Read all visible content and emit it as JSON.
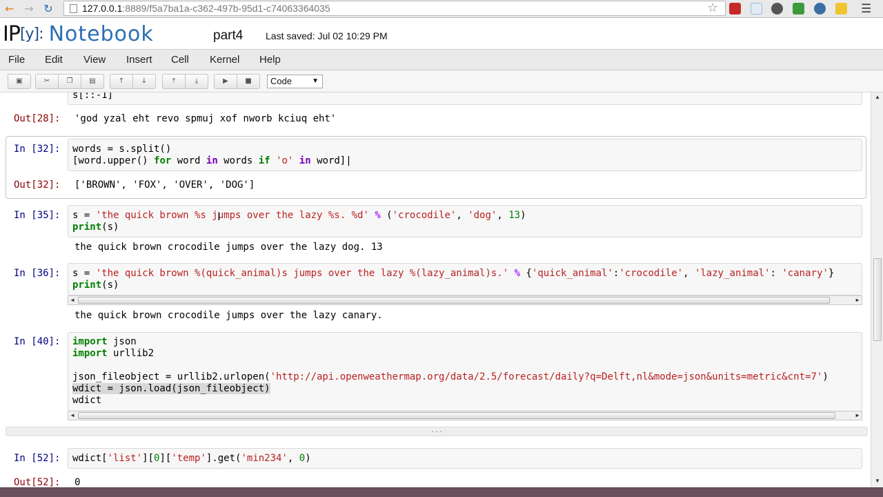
{
  "browser": {
    "url_host": "127.0.0.1",
    "url_path": ":8889/f5a7ba1a-c362-497b-95d1-c74063364035",
    "back_icon": "arrow-left-icon",
    "forward_icon": "arrow-right-icon",
    "reload_icon": "reload-icon",
    "bookmark_icon": "star-icon",
    "menu_icon": "hamburger-icon"
  },
  "header": {
    "logo_ip": "IP",
    "logo_y": "[y]:",
    "logo_notebook": "Notebook",
    "notebook_name": "part4",
    "last_saved": "Last saved: Jul 02 10:29 PM"
  },
  "menu": {
    "items": [
      "File",
      "Edit",
      "View",
      "Insert",
      "Cell",
      "Kernel",
      "Help"
    ]
  },
  "toolbar": {
    "cell_type": "Code",
    "cell_type_options": [
      "Code"
    ]
  },
  "cells": {
    "c28": {
      "partial_input": "s[::-1]",
      "out_prompt": "Out[28]:",
      "output": "'god yzal eht revo spmuj xof nworb kciuq eht'"
    },
    "c32": {
      "in_prompt": "In [32]:",
      "out_prompt": "Out[32]:",
      "output": "['BROWN', 'FOX', 'OVER', 'DOG']"
    },
    "c35": {
      "in_prompt": "In [35]:",
      "output": "the quick brown crocodile jumps over the lazy dog. 13"
    },
    "c36": {
      "in_prompt": "In [36]:",
      "output": "the quick brown crocodile jumps over the lazy canary."
    },
    "c40": {
      "in_prompt": "In [40]:"
    },
    "c52": {
      "in_prompt": "In [52]:",
      "out_prompt": "Out[52]:",
      "output": "0"
    }
  },
  "collapsed_label": "...",
  "colors": {
    "prompt_in": "#000080",
    "prompt_out": "#8b0000",
    "keyword": "#008000",
    "string": "#ba2121"
  }
}
